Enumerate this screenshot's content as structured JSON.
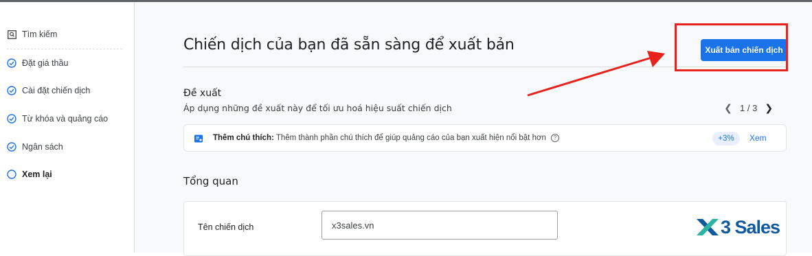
{
  "sidebar": {
    "items": [
      {
        "label": "Tìm kiếm",
        "icon": "search-box-icon",
        "state": "none"
      },
      {
        "label": "Đặt giá thầu",
        "icon": "check-circle-icon",
        "state": "done"
      },
      {
        "label": "Cài đặt chiến dịch",
        "icon": "check-circle-icon",
        "state": "done"
      },
      {
        "label": "Từ khóa và quảng cáo",
        "icon": "check-circle-icon",
        "state": "done"
      },
      {
        "label": "Ngân sách",
        "icon": "check-circle-icon",
        "state": "done"
      },
      {
        "label": "Xem lại",
        "icon": "empty-circle-icon",
        "state": "current"
      }
    ]
  },
  "main": {
    "title": "Chiến dịch của bạn đã sẵn sàng để xuất bản",
    "publish_button": "Xuất bản chiến dịch",
    "recommendations": {
      "title": "Đề xuất",
      "subtitle": "Áp dụng những đề xuất này để tối ưu hoá hiệu suất chiến dịch",
      "pager": "1 / 3",
      "card": {
        "label": "Thêm chú thích:",
        "text": "Thêm thành phần chú thích để giúp quảng cáo của bạn xuất hiện nổi bật hơn",
        "badge": "+3%",
        "view": "Xem"
      }
    },
    "overview": {
      "title": "Tổng quan",
      "campaign_name_label": "Tên chiến dịch",
      "campaign_name_value": "x3sales.vn"
    }
  },
  "watermark": {
    "text": "3 Sales"
  },
  "colors": {
    "accent": "#1a73e8",
    "annotation": "#e8211d",
    "logo": "#0f5a9e"
  }
}
